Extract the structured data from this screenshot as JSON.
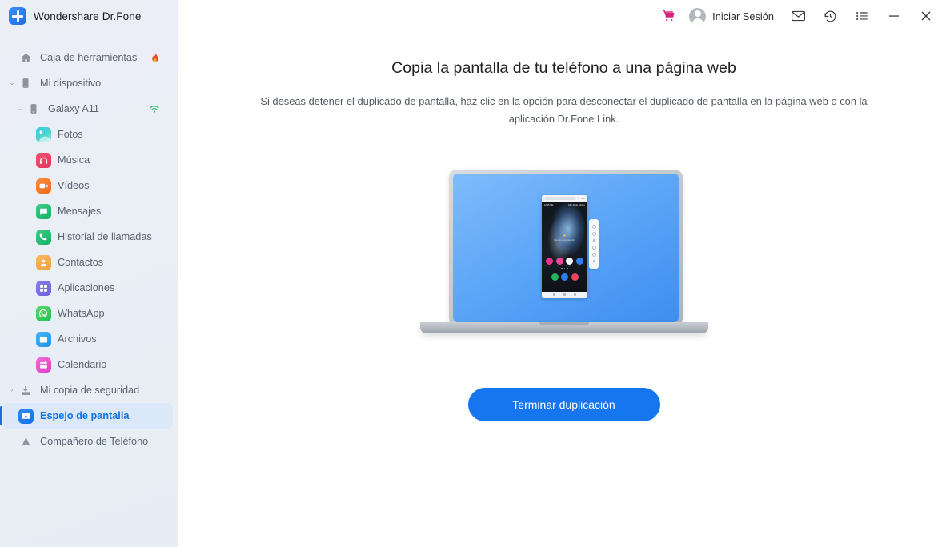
{
  "app": {
    "title": "Wondershare Dr.Fone",
    "logo_icon": "drfone-plus-logo-icon"
  },
  "sidebar": {
    "items": [
      {
        "id": "toolbox",
        "label": "Caja de herramientas",
        "icon": "home-icon",
        "level": 0,
        "caret": "",
        "trailing": "fire-icon",
        "selected": false
      },
      {
        "id": "my-device",
        "label": "Mi dispositivo",
        "icon": "phone-icon",
        "level": "0b",
        "caret": "⌄",
        "trailing": "",
        "selected": false
      },
      {
        "id": "galaxy-a11",
        "label": "Galaxy A11",
        "icon": "phone-icon",
        "level": 1,
        "caret": "⌄",
        "trailing": "wifi-icon",
        "selected": false
      },
      {
        "id": "photos",
        "label": "Fotos",
        "icon": "photos-icon",
        "level": 2,
        "caret": "",
        "trailing": "",
        "selected": false
      },
      {
        "id": "music",
        "label": "Música",
        "icon": "music-icon",
        "level": 2,
        "caret": "",
        "trailing": "",
        "selected": false
      },
      {
        "id": "videos",
        "label": "Vídeos",
        "icon": "videos-icon",
        "level": 2,
        "caret": "",
        "trailing": "",
        "selected": false
      },
      {
        "id": "messages",
        "label": "Mensajes",
        "icon": "messages-icon",
        "level": 2,
        "caret": "",
        "trailing": "",
        "selected": false
      },
      {
        "id": "call-history",
        "label": "Historial de llamadas",
        "icon": "call-icon",
        "level": 2,
        "caret": "",
        "trailing": "",
        "selected": false
      },
      {
        "id": "contacts",
        "label": "Contactos",
        "icon": "contacts-icon",
        "level": 2,
        "caret": "",
        "trailing": "",
        "selected": false
      },
      {
        "id": "apps",
        "label": "Aplicaciones",
        "icon": "apps-icon",
        "level": 2,
        "caret": "",
        "trailing": "",
        "selected": false
      },
      {
        "id": "whatsapp",
        "label": "WhatsApp",
        "icon": "whatsapp-icon",
        "level": 2,
        "caret": "",
        "trailing": "",
        "selected": false
      },
      {
        "id": "files",
        "label": "Archivos",
        "icon": "files-icon",
        "level": 2,
        "caret": "",
        "trailing": "",
        "selected": false
      },
      {
        "id": "calendar",
        "label": "Calendario",
        "icon": "calendar-icon",
        "level": 2,
        "caret": "",
        "trailing": "",
        "selected": false
      },
      {
        "id": "my-backup",
        "label": "Mi copia de seguridad",
        "icon": "backup-icon",
        "level": "0b",
        "caret": "›",
        "trailing": "",
        "selected": false
      },
      {
        "id": "screen-mirror",
        "label": "Espejo de pantalla",
        "icon": "screen-mirror-icon",
        "level": "0b2",
        "caret": "",
        "trailing": "",
        "selected": true
      },
      {
        "id": "phone-companion",
        "label": "Compañero de Teléfono",
        "icon": "companion-icon",
        "level": 0,
        "caret": "",
        "trailing": "",
        "selected": false
      }
    ]
  },
  "topbar": {
    "cart_icon": "shopping-cart-icon",
    "login_label": "Iniciar Sesión",
    "avatar_icon": "user-avatar-icon",
    "mail_icon": "mail-icon",
    "history_icon": "history-clock-icon",
    "menu_icon": "list-menu-icon",
    "minimize_icon": "minimize-icon",
    "close_icon": "close-icon"
  },
  "main": {
    "headline": "Copia la pantalla de tu teléfono a una página web",
    "subtext": "Si deseas detener el duplicado de pantalla, haz clic en la opción para desconectar el duplicado de pantalla en la página web o con la aplicación Dr.Fone Link.",
    "cta_label": "Terminar duplicación",
    "illustration": {
      "name": "laptop-mirroring-phone-illustration",
      "phone": {
        "status_time": "10:45 Mié",
        "status_date": "Mar 30 de febrero",
        "tip": "Toca dos veces para abrir",
        "dock_row1": [
          {
            "label": "Galaxy Store",
            "color": "#e8338c"
          },
          {
            "label": "Ajustes",
            "color": "#ec4899"
          },
          {
            "label": "Play Store",
            "color": "#f5f7fa"
          },
          {
            "label": "Chat",
            "color": "#2f7ef0"
          }
        ],
        "dock_row2": [
          {
            "label": "",
            "color": "#23b45d"
          },
          {
            "label": "",
            "color": "#2f7ef0"
          },
          {
            "label": "",
            "color": "#e8455f"
          }
        ]
      }
    }
  },
  "colors": {
    "accent": "#1576ef",
    "sidebar_bg": "#e9eff5",
    "selected_bg": "#dbe8f8",
    "screen_blue": "#4b97f4"
  }
}
